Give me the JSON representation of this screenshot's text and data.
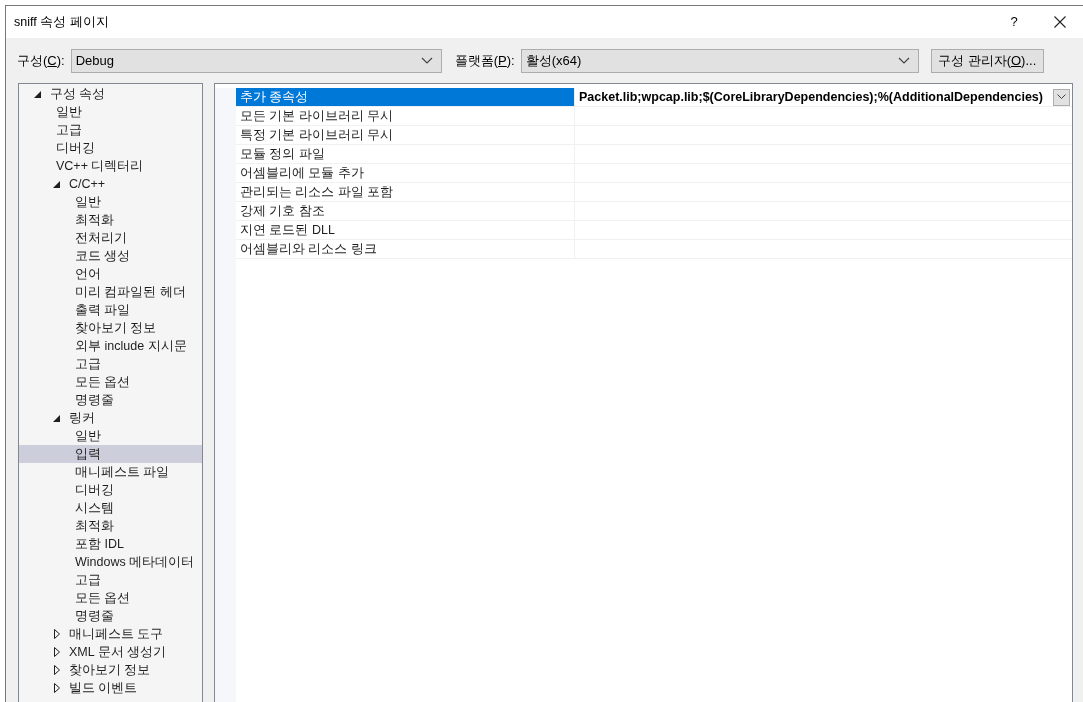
{
  "window": {
    "title": "sniff 속성 페이지",
    "help": "?"
  },
  "config": {
    "label": "구성(",
    "mnemonic": "C",
    "label_end": "):",
    "value": "Debug"
  },
  "platform": {
    "label": "플랫폼(",
    "mnemonic": "P",
    "label_end": "):",
    "value": "활성(x64)"
  },
  "manager_button": {
    "label": "구성 관리자(",
    "mnemonic": "O",
    "label_end": ")..."
  },
  "tree": [
    {
      "label": "구성 속성",
      "expanded": true,
      "selected": false,
      "children": [
        {
          "label": "일반",
          "selected": false
        },
        {
          "label": "고급",
          "selected": false
        },
        {
          "label": "디버깅",
          "selected": false
        },
        {
          "label": "VC++ 디렉터리",
          "selected": false
        },
        {
          "label": "C/C++",
          "expanded": true,
          "selected": false,
          "children": [
            {
              "label": "일반",
              "selected": false
            },
            {
              "label": "최적화",
              "selected": false
            },
            {
              "label": "전처리기",
              "selected": false
            },
            {
              "label": "코드 생성",
              "selected": false
            },
            {
              "label": "언어",
              "selected": false
            },
            {
              "label": "미리 컴파일된 헤더",
              "selected": false
            },
            {
              "label": "출력 파일",
              "selected": false
            },
            {
              "label": "찾아보기 정보",
              "selected": false
            },
            {
              "label": "외부 include 지시문",
              "selected": false
            },
            {
              "label": "고급",
              "selected": false
            },
            {
              "label": "모든 옵션",
              "selected": false
            },
            {
              "label": "명령줄",
              "selected": false
            }
          ]
        },
        {
          "label": "링커",
          "expanded": true,
          "selected": false,
          "children": [
            {
              "label": "일반",
              "selected": false
            },
            {
              "label": "입력",
              "selected": true
            },
            {
              "label": "매니페스트 파일",
              "selected": false
            },
            {
              "label": "디버깅",
              "selected": false
            },
            {
              "label": "시스템",
              "selected": false
            },
            {
              "label": "최적화",
              "selected": false
            },
            {
              "label": "포함 IDL",
              "selected": false
            },
            {
              "label": "Windows 메타데이터",
              "selected": false
            },
            {
              "label": "고급",
              "selected": false
            },
            {
              "label": "모든 옵션",
              "selected": false
            },
            {
              "label": "명령줄",
              "selected": false
            }
          ]
        },
        {
          "label": "매니페스트 도구",
          "expanded": false,
          "selected": false
        },
        {
          "label": "XML 문서 생성기",
          "expanded": false,
          "selected": false
        },
        {
          "label": "찾아보기 정보",
          "expanded": false,
          "selected": false
        },
        {
          "label": "빌드 이벤트",
          "expanded": false,
          "selected": false
        }
      ]
    }
  ],
  "properties": [
    {
      "name": "추가 종속성",
      "value": "Packet.lib;wpcap.lib;$(CoreLibraryDependencies);%(AdditionalDependencies)",
      "selected": true
    },
    {
      "name": "모든 기본 라이브러리 무시",
      "selected": false
    },
    {
      "name": "특정 기본 라이브러리 무시",
      "selected": false
    },
    {
      "name": "모듈 정의 파일",
      "selected": false
    },
    {
      "name": "어셈블리에 모듈 추가",
      "selected": false
    },
    {
      "name": "관리되는 리소스 파일 포함",
      "selected": false
    },
    {
      "name": "강제 기호 참조",
      "selected": false
    },
    {
      "name": "지연 로드된 DLL",
      "selected": false
    },
    {
      "name": "어셈블리와 리소스 링크",
      "selected": false
    }
  ]
}
